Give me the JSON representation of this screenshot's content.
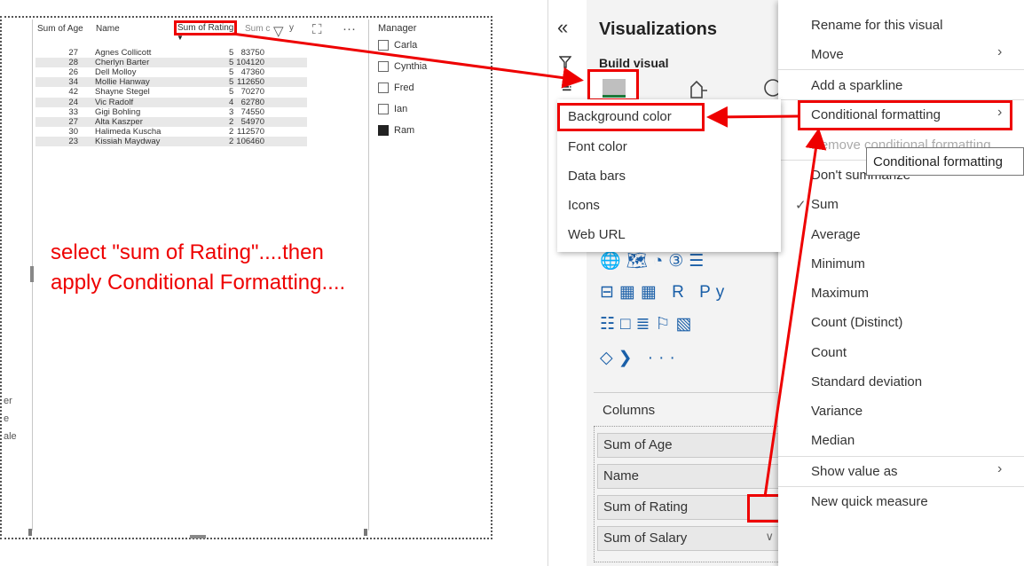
{
  "report": {
    "edge_text": [
      "er",
      "e",
      "ale"
    ],
    "table": {
      "headers": [
        "Sum of Age",
        "Name",
        "Sum of Rating",
        "Sum c"
      ],
      "rows": [
        [
          "27",
          "Agnes Collicott",
          "5",
          "83750"
        ],
        [
          "28",
          "Cherlyn Barter",
          "5",
          "104120"
        ],
        [
          "26",
          "Dell Molloy",
          "5",
          "47360"
        ],
        [
          "34",
          "Mollie Hanway",
          "5",
          "112650"
        ],
        [
          "42",
          "Shayne Stegel",
          "5",
          "70270"
        ],
        [
          "24",
          "Vic Radolf",
          "4",
          "62780"
        ],
        [
          "33",
          "Gigi Bohling",
          "3",
          "74550"
        ],
        [
          "27",
          "Alta Kaszper",
          "2",
          "54970"
        ],
        [
          "30",
          "Halimeda Kuscha",
          "2",
          "112570"
        ],
        [
          "23",
          "Kissiah Maydway",
          "2",
          "106460"
        ]
      ]
    },
    "visual_icons": [
      "filter-icon",
      "focus-mode-icon",
      "more-options-icon"
    ],
    "visual_icon_glyphs": {
      "filter": "▽",
      "focus": "⛶",
      "more": "···",
      "y": "y"
    },
    "slicer": {
      "title": "Manager",
      "items": [
        {
          "label": "Carla",
          "checked": false
        },
        {
          "label": "Cynthia",
          "checked": false
        },
        {
          "label": "Fred",
          "checked": false
        },
        {
          "label": "Ian",
          "checked": false
        },
        {
          "label": "Ram",
          "checked": true
        }
      ]
    },
    "annotation_line1": "select \"sum of Rating\"....then",
    "annotation_line2": "apply Conditional Formatting...."
  },
  "pane": {
    "collapse_glyph": "«",
    "filters_label": "Fil",
    "title": "Visualizations",
    "build_label": "Build visual",
    "gallery_rows": [
      "🌐🗺◔③☰",
      "⊟▦▦ R Py",
      "☷□≣⚐▧",
      "◇❯ ···"
    ],
    "columns_label": "Columns",
    "wells": [
      {
        "label": "Sum of Age",
        "chevron": "∨",
        "remove": ""
      },
      {
        "label": "Name",
        "chevron": "∨",
        "remove": ""
      },
      {
        "label": "Sum of Rating",
        "chevron": "∨",
        "remove": ""
      },
      {
        "label": "Sum of Salary",
        "chevron": "∨",
        "remove": "✕"
      }
    ]
  },
  "context_menu": {
    "items": [
      "Rename for this visual",
      "Move",
      "Add a sparkline",
      "Conditional formatting",
      "Remove conditional formatting",
      "Don't summarize",
      "Sum",
      "Average",
      "Minimum",
      "Maximum",
      "Count (Distinct)",
      "Count",
      "Standard deviation",
      "Variance",
      "Median",
      "Show value as",
      "New quick measure"
    ],
    "arrow_glyph": "›",
    "check_glyph": "✓",
    "tooltip": "Conditional formatting"
  },
  "submenu": {
    "items": [
      "Background color",
      "Font color",
      "Data bars",
      "Icons",
      "Web URL"
    ]
  },
  "colors": {
    "annotation": "#e00000",
    "highlight_box": "#e00000",
    "pane_bg": "#f3f3f3"
  }
}
